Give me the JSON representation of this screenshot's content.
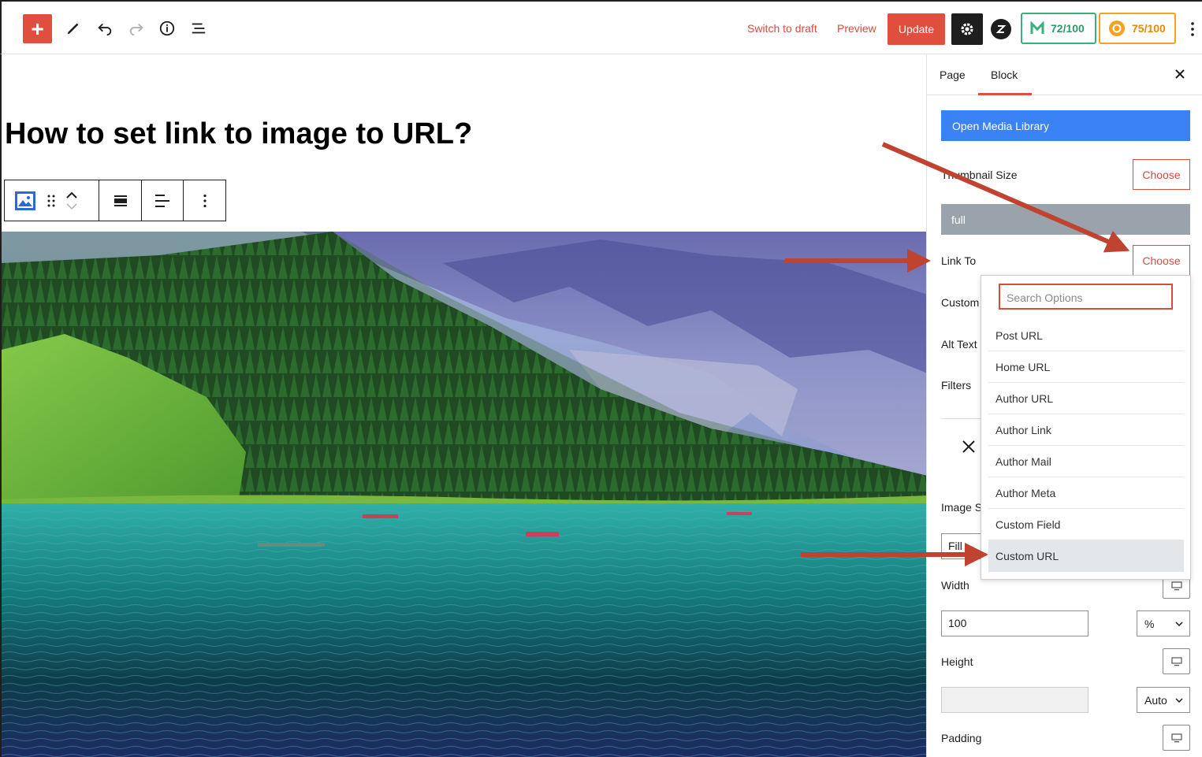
{
  "toolbar": {
    "switch_to_draft": "Switch to draft",
    "preview": "Preview",
    "update": "Update",
    "score1": "72/100",
    "score2": "75/100"
  },
  "post": {
    "title": "How to set link to image to URL?"
  },
  "sidebar": {
    "tabs": [
      "Page",
      "Block"
    ],
    "active_tab": "Block",
    "open_media_library": "Open Media Library",
    "thumbnail_size_label": "Thumbnail Size",
    "choose_label": "Choose",
    "thumbnail_size_value": "full",
    "link_to_label": "Link To",
    "custom_label": "Custom",
    "alt_text_label": "Alt Text",
    "filters_label": "Filters",
    "image_size_label": "Image S",
    "fill_value": "Fill",
    "width_label": "Width",
    "width_value": "100",
    "width_unit": "%",
    "height_label": "Height",
    "height_unit": "Auto",
    "padding_label": "Padding"
  },
  "dropdown": {
    "search_placeholder": "Search Options",
    "options": [
      "Post URL",
      "Home URL",
      "Author URL",
      "Author Link",
      "Author Mail",
      "Author Meta",
      "Custom Field",
      "Custom URL"
    ],
    "selected": "Custom URL"
  },
  "colors": {
    "accent": "#e04e3e",
    "media_blue": "#3b82f6",
    "annotation_arrow": "#c0432f"
  },
  "icons": [
    "plus-icon",
    "pencil-icon",
    "undo-icon",
    "redo-icon",
    "info-icon",
    "list-view-icon",
    "gear-icon",
    "z-logo-icon",
    "kebab-icon",
    "image-block-icon",
    "drag-handle-icon",
    "move-up-icon",
    "move-down-icon",
    "align-wide-icon",
    "align-left-icon",
    "close-icon",
    "desktop-icon",
    "chevron-down-icon"
  ]
}
